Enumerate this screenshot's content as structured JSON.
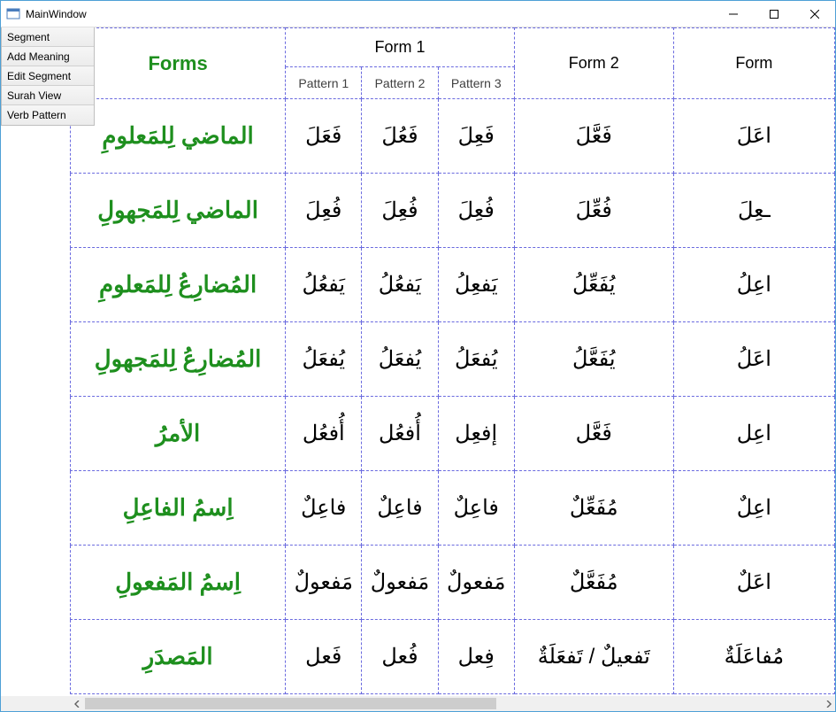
{
  "window": {
    "title": "MainWindow"
  },
  "toolstrip": {
    "items": [
      {
        "label": "Segment"
      },
      {
        "label": "Add Meaning"
      },
      {
        "label": "Edit Segment"
      },
      {
        "label": "Surah View"
      },
      {
        "label": "Verb Pattern"
      }
    ]
  },
  "grid": {
    "forms_label": "Forms",
    "form_headers": {
      "form1": "Form 1",
      "form2": "Form 2",
      "form3": "Form"
    },
    "pattern_headers": {
      "p1": "Pattern 1",
      "p2": "Pattern 2",
      "p3": "Pattern 3"
    },
    "rows": [
      {
        "label": "الماضي لِلمَعلومِ",
        "p1": "فَعَلَ",
        "p2": "فَعُلَ",
        "p3": "فَعِلَ",
        "form2": "فَعَّلَ",
        "form3": "اعَلَ"
      },
      {
        "label": "الماضي لِلمَجهولِ",
        "p1": "فُعِلَ",
        "p2": "فُعِلَ",
        "p3": "فُعِلَ",
        "form2": "فُعِّلَ",
        "form3": "ـعِلَ"
      },
      {
        "label": "المُضارِعُ لِلمَعلومِ",
        "p1": "يَفعُلُ",
        "p2": "يَفعُلُ",
        "p3": "يَفعِلُ",
        "form2": "يُفَعِّلُ",
        "form3": "اعِلُ"
      },
      {
        "label": "المُضارِعُ لِلمَجهولِ",
        "p1": "يُفعَلُ",
        "p2": "يُفعَلُ",
        "p3": "يُفعَلُ",
        "form2": "يُفَعَّلُ",
        "form3": "اعَلُ"
      },
      {
        "label": "الأمرُ",
        "p1": "أُفعُل",
        "p2": "أُفعُل",
        "p3": "إفعِل",
        "form2": "فَعَّل",
        "form3": "اعِل"
      },
      {
        "label": "اِسمُ الفاعِلِ",
        "p1": "فاعِلٌ",
        "p2": "فاعِلٌ",
        "p3": "فاعِلٌ",
        "form2": "مُفَعِّلٌ",
        "form3": "اعِلٌ"
      },
      {
        "label": "اِسمُ المَفعولِ",
        "p1": "مَفعولٌ",
        "p2": "مَفعولٌ",
        "p3": "مَفعولٌ",
        "form2": "مُفَعَّلٌ",
        "form3": "اعَلٌ"
      },
      {
        "label": "المَصدَرِ",
        "p1": "فَعل",
        "p2": "فُعل",
        "p3": "فِعل",
        "form2": "تَفعيلٌ / تَفعَلَةٌ",
        "form3": "مُفاعَلَةٌ"
      }
    ]
  }
}
